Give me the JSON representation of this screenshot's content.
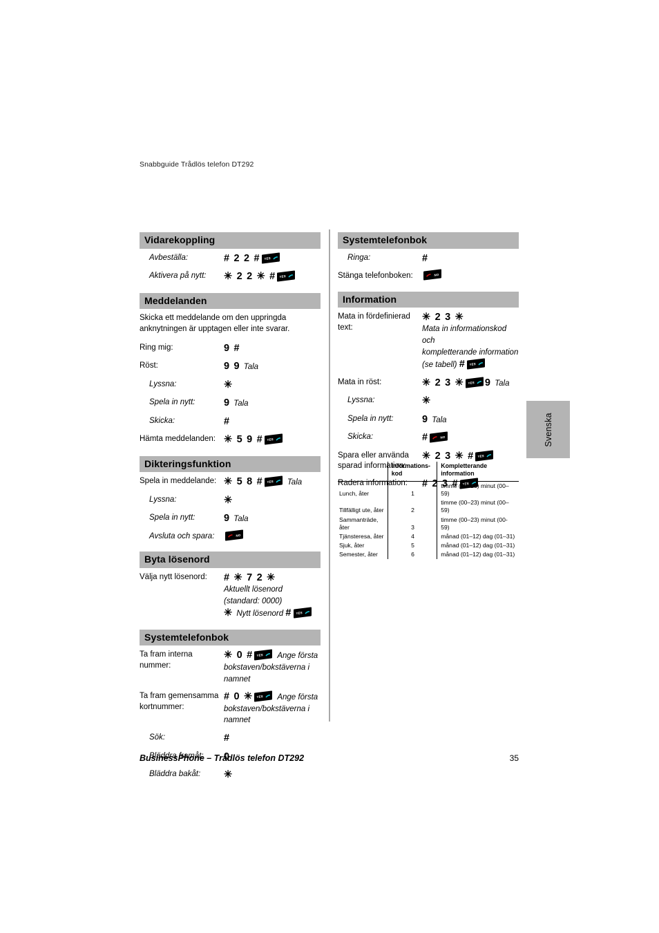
{
  "document": {
    "header": "Snabbguide Trådlös telefon DT292",
    "footer_title": "BusinessPhone – Trådlös telefon DT292",
    "page_number": "35",
    "side_tab": "Svenska"
  },
  "icons": {
    "yes_key": "yes-key-icon",
    "no_key": "no-key-icon",
    "yes_label": "YES",
    "no_label": "NO"
  },
  "left_column": {
    "sections": [
      {
        "title": "Vidarekoppling",
        "rows": [
          {
            "label": "Avbeställa:",
            "code": "# 2 2 #",
            "key": "yes"
          },
          {
            "label": "Aktivera på nytt:",
            "code": "✳ 2 2 ✳ #",
            "key": "yes"
          }
        ]
      },
      {
        "title": "Meddelanden",
        "intro": "Skicka ett meddelande om den uppringda anknytningen är upptagen eller inte svarar.",
        "rows": [
          {
            "label": "Ring mig:",
            "code": "9 #"
          },
          {
            "label": "Röst:",
            "code": "9 9",
            "note": "Tala"
          },
          {
            "label": "Lyssna:",
            "code": "✳",
            "indent": true
          },
          {
            "label": "Spela in nytt:",
            "code": "9",
            "note": "Tala",
            "indent": true
          },
          {
            "label": "Skicka:",
            "code": "#",
            "indent": true
          },
          {
            "label": "Hämta meddelanden:",
            "code": "✳ 5 9 #",
            "key": "yes"
          }
        ]
      },
      {
        "title": "Dikteringsfunktion",
        "rows": [
          {
            "label": "Spela in meddelande:",
            "code": "✳ 5 8 #",
            "key": "yes",
            "note": "Tala"
          },
          {
            "label": "Lyssna:",
            "code": "✳",
            "indent": true
          },
          {
            "label": "Spela in nytt:",
            "code": "9",
            "note": "Tala",
            "indent": true
          },
          {
            "label": "Avsluta och spara:",
            "code": "",
            "key": "no",
            "indent": true
          }
        ]
      },
      {
        "title": "Byta lösenord",
        "rows": [
          {
            "label": "Välja nytt lösenord:",
            "code": "# ✳ 7 2 ✳",
            "extra_lines": [
              "Aktuellt lösenord",
              "(standard: 0000)"
            ],
            "final_code": "✳",
            "final_note": "Nytt lösenord",
            "final_code2": "#",
            "key": "yes"
          }
        ]
      },
      {
        "title": "Systemtelefonbok",
        "rows": [
          {
            "label": "Ta fram interna nummer:",
            "code": "✳ 0 #",
            "key": "yes",
            "note": "Ange första",
            "extra_lines": [
              "bokstaven/bokstäverna i",
              "namnet"
            ]
          },
          {
            "label": "Ta fram gemensamma kortnummer:",
            "code": "# 0 ✳",
            "key": "yes",
            "note": "Ange första",
            "extra_lines": [
              "bokstaven/bokstäverna i",
              "namnet"
            ]
          },
          {
            "label": "Sök:",
            "code": "#",
            "indent": true
          },
          {
            "label": "Bläddra framåt:",
            "code": "0",
            "indent": true
          },
          {
            "label": "Bläddra bakåt:",
            "code": "✳",
            "indent": true
          }
        ]
      }
    ]
  },
  "right_column": {
    "sections": [
      {
        "title": "Systemtelefonbok",
        "rows": [
          {
            "label": "Ringa:",
            "code": "#",
            "indent": true
          },
          {
            "label": "Stänga telefonboken:",
            "code": "",
            "key": "no"
          }
        ]
      },
      {
        "title": "Information",
        "rows": [
          {
            "label": "Mata in fördefinierad text:",
            "code": "✳ 2 3 ✳",
            "extra_lines": [
              "Mata in informationskod och",
              "kompletterande information"
            ],
            "final_note": "(se tabell)",
            "final_code2": "#",
            "key": "yes"
          },
          {
            "label": "Mata in röst:",
            "code": "✳ 2 3 ✳",
            "key": "yes",
            "code2": "9",
            "note": "Tala"
          },
          {
            "label": "Lyssna:",
            "code": "✳",
            "indent": true
          },
          {
            "label": "Spela in nytt:",
            "code": "9",
            "note": "Tala",
            "indent": true
          },
          {
            "label": "Skicka:",
            "code": "#",
            "key": "no",
            "indent": true
          },
          {
            "label": "Spara eller använda sparad information:",
            "code": "✳ 2 3 ✳ #",
            "key": "yes"
          },
          {
            "label": "Radera information:",
            "code": "# 2 3 #",
            "key": "yes"
          }
        ]
      }
    ]
  },
  "code_table": {
    "headers": [
      "",
      "Informations- kod",
      "Kompletterande information"
    ],
    "header_col1_line1": "Informations-",
    "header_col1_line2": "kod",
    "header_col2_line1": "Kompletterande",
    "header_col2_line2": "information",
    "rows": [
      {
        "name": "Lunch, åter",
        "code": "1",
        "info": "timme (00–23) minut (00–59)"
      },
      {
        "name": "Tillfälligt ute, åter",
        "code": "2",
        "info": "timme (00–23) minut (00–59)"
      },
      {
        "name": "Sammanträde, åter",
        "code": "3",
        "info": "timme (00–23) minut (00-59)"
      },
      {
        "name": "Tjänsteresa, åter",
        "code": "4",
        "info": "månad (01–12) dag (01–31)"
      },
      {
        "name": "Sjuk, åter",
        "code": "5",
        "info": "månad (01–12) dag (01–31)"
      },
      {
        "name": "Semester, åter",
        "code": "6",
        "info": "månad (01–12) dag (01–31)"
      }
    ]
  }
}
